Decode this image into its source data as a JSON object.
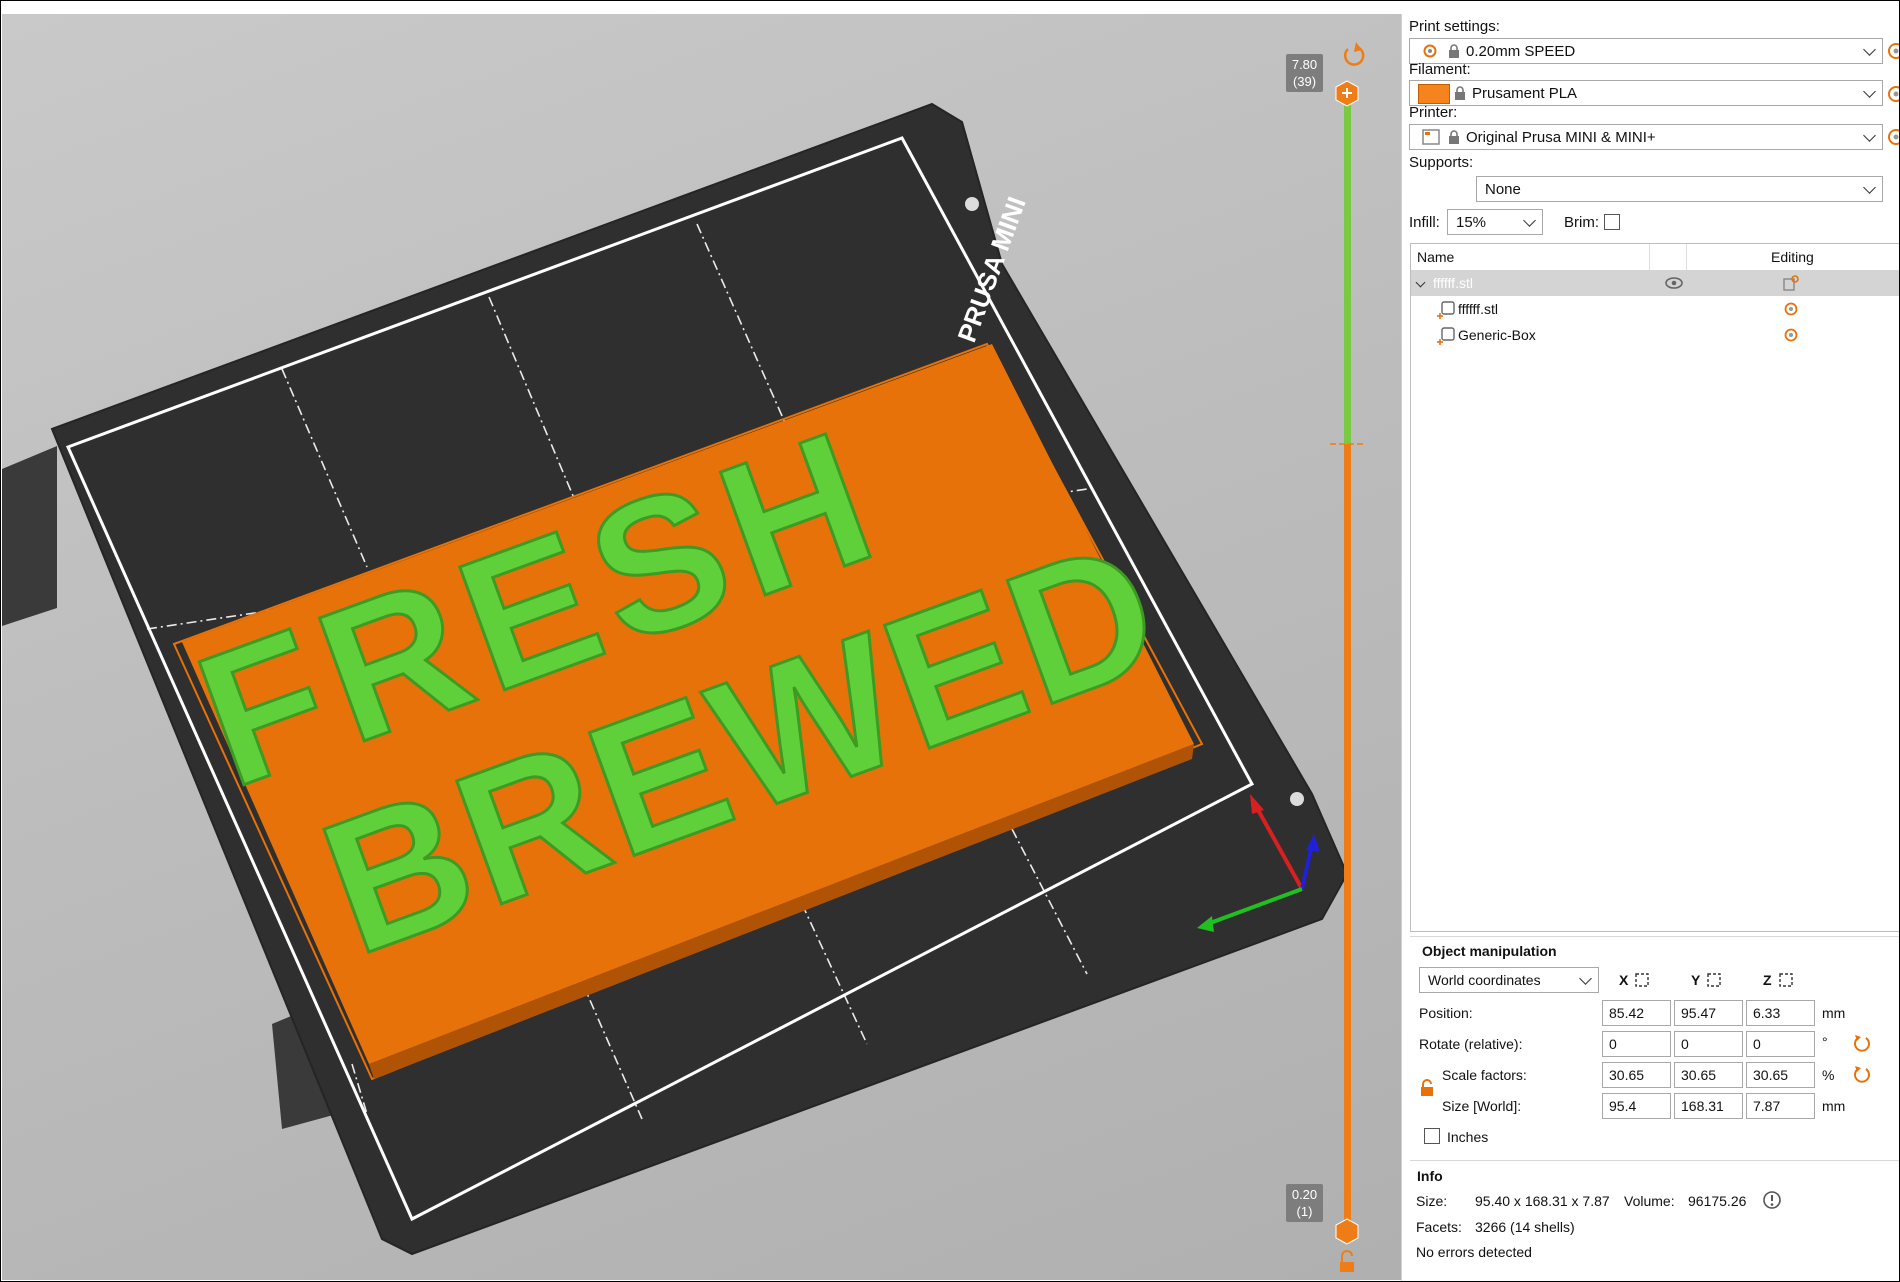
{
  "viewport": {
    "bed_label": "PRUSA MINI",
    "slider_top": {
      "value": "7.80",
      "layer": "(39)"
    },
    "slider_bottom": {
      "value": "0.20",
      "layer": "(1)"
    },
    "model_text_line1": "FRESH",
    "model_text_line2": "BREWED",
    "colors": {
      "green": "#5fcf3a",
      "orange": "#e8720a",
      "bed": "#2f2f2f",
      "slider_green": "#7ac943",
      "slider_orange": "#ef7d17"
    }
  },
  "panel": {
    "print_settings_label": "Print settings:",
    "print_settings_value": "0.20mm SPEED",
    "filament_label": "Filament:",
    "filament_value": "Prusament PLA",
    "filament_color": "#f5841f",
    "printer_label": "Printer:",
    "printer_value": "Original Prusa MINI & MINI+",
    "supports_label": "Supports:",
    "supports_value": "None",
    "infill_label": "Infill:",
    "infill_value": "15%",
    "brim_label": "Brim:"
  },
  "object_list": {
    "col_name": "Name",
    "col_editing": "Editing",
    "rows": [
      {
        "name": "ffffff.stl"
      },
      {
        "name": "ffffff.stl"
      },
      {
        "name": "Generic-Box"
      }
    ]
  },
  "manipulation": {
    "title": "Object manipulation",
    "coord_system": "World coordinates",
    "axes": [
      "X",
      "Y",
      "Z"
    ],
    "position_label": "Position:",
    "position": [
      "85.42",
      "95.47",
      "6.33"
    ],
    "position_unit": "mm",
    "rotate_label": "Rotate (relative):",
    "rotate": [
      "0",
      "0",
      "0"
    ],
    "rotate_unit": "°",
    "scale_label": "Scale factors:",
    "scale": [
      "30.65",
      "30.65",
      "30.65"
    ],
    "scale_unit": "%",
    "size_label": "Size [World]:",
    "size": [
      "95.4",
      "168.31",
      "7.87"
    ],
    "size_unit": "mm",
    "inches_label": "Inches"
  },
  "info": {
    "title": "Info",
    "size_label": "Size:",
    "size_value": "95.40 x 168.31 x 7.87",
    "volume_label": "Volume:",
    "volume_value": "96175.26",
    "facets_label": "Facets:",
    "facets_value": "3266 (14 shells)",
    "status": "No errors detected"
  }
}
